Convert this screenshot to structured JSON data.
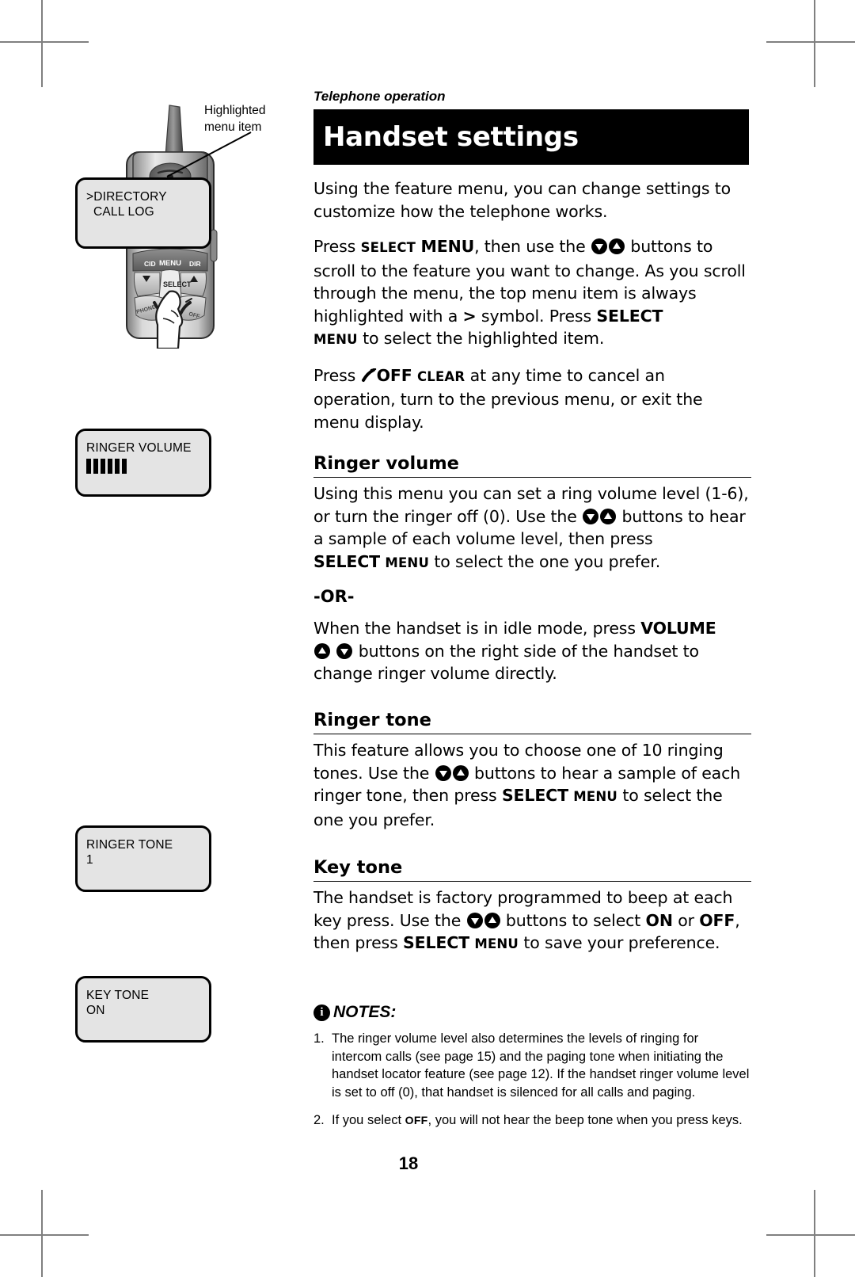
{
  "page": {
    "number": "18",
    "eyebrow": "Telephone operation",
    "title": "Handset settings"
  },
  "sidebar": {
    "callout": {
      "line1": "Highlighted",
      "line2": "menu item"
    },
    "handset": {
      "soft_keys": [
        "CID",
        "MENU",
        "DIR"
      ],
      "select_key": "SELECT"
    },
    "screens": [
      {
        "name": "menu-screen",
        "line1": ">DIRECTORY",
        "line2": "CALL LOG"
      },
      {
        "name": "ringer-volume-screen",
        "line1": "RINGER VOLUME",
        "bars": 6
      },
      {
        "name": "ringer-tone-screen",
        "line1": "RINGER TONE",
        "line2": "1"
      },
      {
        "name": "key-tone-screen",
        "line1": "KEY TONE",
        "line2": "ON"
      }
    ]
  },
  "content": {
    "intro": {
      "p1": "Using the feature menu, you can change settings to customize how the telephone works.",
      "p2_a": "Press ",
      "p2_select": "SELECT",
      "p2_menu": "MENU",
      "p2_b": ", then use the ",
      "p2_c": " buttons to scroll to the feature you want to change. As you scroll through the menu, the top menu item is always highlighted with a ",
      "p2_symbol": ">",
      "p2_d": " symbol. Press ",
      "p2_select2": "SELECT",
      "p2_menu2": "MENU",
      "p2_e": " to select the highlighted item.",
      "p3_a": "Press ",
      "p3_off": "OFF",
      "p3_clear": "CLEAR",
      "p3_b": " at any time to cancel an operation, turn to the previous menu, or exit the menu display."
    },
    "sections": [
      {
        "heading": "Ringer volume",
        "p1_a": "Using this menu you can set a ring volume level (1-6), or turn the ringer off (0). Use the ",
        "p1_b": " buttons to hear a sample of each volume level, then press ",
        "p1_select": "SELECT",
        "p1_menu": "MENU",
        "p1_c": " to select the one you prefer.",
        "or": "-OR-",
        "p2_a": "When the handset is in idle mode, press ",
        "p2_volume": "VOLUME",
        "p2_b": " buttons on the right side of the handset to change ringer volume directly."
      },
      {
        "heading": "Ringer tone",
        "p1_a": "This feature allows you to choose one of 10 ringing tones. Use the ",
        "p1_b": " buttons to hear a sample of each ringer tone, then press ",
        "p1_select": "SELECT",
        "p1_menu": "MENU",
        "p1_c": " to select the one you prefer."
      },
      {
        "heading": "Key tone",
        "p1_a": "The handset is factory programmed to beep at each key press. Use the ",
        "p1_b": " buttons to select ",
        "p1_on": "ON",
        "p1_c": " or ",
        "p1_off": "OFF",
        "p1_d": ", then press ",
        "p1_select": "SELECT",
        "p1_menu": "MENU",
        "p1_e": " to save your preference."
      }
    ],
    "notes": {
      "heading": "NOTES:",
      "items": [
        {
          "num": "1.",
          "text": "The ringer volume level also determines the levels of ringing for intercom calls (see page 15) and the paging tone when initiating the handset locator feature (see page 12).  If the handset ringer volume level is set to off (0), that handset is silenced for all calls and paging."
        },
        {
          "num": "2.",
          "text_a": "If you select ",
          "text_off": "OFF",
          "text_b": ", you will not hear the beep tone when you press keys."
        }
      ]
    }
  },
  "colors": {
    "title_bar_bg": "#000000",
    "title_text": "#ffffff",
    "lcd_bg": "#e4e4e4",
    "crop_mark": "#808080"
  }
}
